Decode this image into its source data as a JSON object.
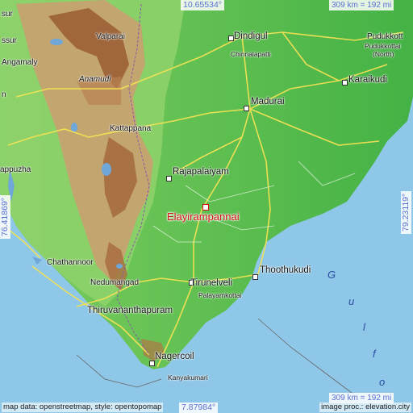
{
  "top_coord": "10.65534°",
  "bottom_coord": "7.87984°",
  "left_coord": "76.41869°",
  "right_coord": "79.23119°",
  "scale_top": "309 km = 192 mi",
  "scale_bottom": "309 km = 192 mi",
  "attribution_left": "map data: openstreetmap, style: opentopomap",
  "attribution_right": "image proc.: elevation.city",
  "target": "Elayirampannai",
  "gulf_letters": [
    "G",
    "u",
    "l",
    "f",
    "o"
  ],
  "places": {
    "dindigul": "Dindigul",
    "chinnalapatti": "Chinnalapatti",
    "pudukkottai": "Pudukkott",
    "pudukkottai_north": "Pudukkottai",
    "north": "(North)",
    "karaikudi": "Karaikudi",
    "madurai": "Madurai",
    "valparai": "Valparai",
    "angamaly": "Angamaly",
    "amamly": "Angamaly",
    "anamudi": "Anamudi",
    "kattappana": "Kattappana",
    "rajapalaiyam": "Rajapalaiyam",
    "appuzha": "appuzha",
    "chathannoor": "Chathannoor",
    "nedumangad": "Nedumangad",
    "thiruvananthapuram": "Thiruvananthapuram",
    "tirunelveli": "Tirunelveli",
    "palayamkottai": "Palayamkottai",
    "thoothukudi": "Thoothukudi",
    "nagercoil": "Nagercoil",
    "kanyakumari": "Kanyakumari",
    "sur": "sur",
    "ssur": "ssur",
    "n": "n"
  },
  "colors": {
    "sea": "#8fc7e8",
    "plain": "#5cbf4a",
    "lowland": "#86cf68",
    "hills": "#c9a070",
    "peaks": "#9a5c34",
    "target": "#d01010",
    "coord_text": "#5a6fd0"
  }
}
